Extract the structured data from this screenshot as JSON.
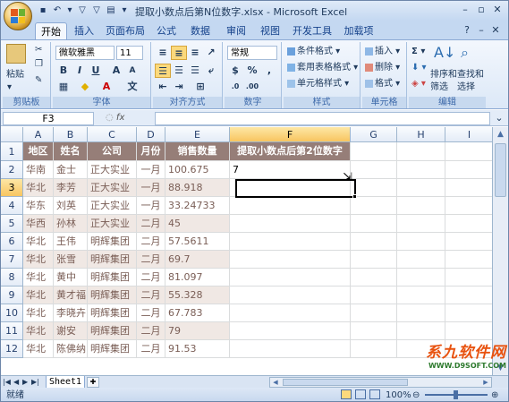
{
  "window": {
    "title": "提取小数点后第N位数字.xlsx - Microsoft Excel"
  },
  "tabs": [
    "开始",
    "插入",
    "页面布局",
    "公式",
    "数据",
    "审阅",
    "视图",
    "开发工具",
    "加载项"
  ],
  "ribbon": {
    "clipboard": {
      "paste": "粘贴",
      "label": "剪贴板"
    },
    "font": {
      "name": "微软雅黑",
      "size": "11",
      "label": "字体"
    },
    "align": {
      "label": "对齐方式"
    },
    "number": {
      "format": "常规",
      "label": "数字"
    },
    "styles": {
      "cond": "条件格式",
      "table": "套用表格格式",
      "cell": "单元格样式",
      "label": "样式"
    },
    "cells": {
      "insert": "插入",
      "delete": "删除",
      "format": "格式",
      "label": "单元格"
    },
    "edit": {
      "sort": "排序和",
      "filter": "筛选",
      "find": "查找和",
      "select": "选择",
      "label": "编辑"
    }
  },
  "formula_bar": {
    "name_box": "F3",
    "fx": "fx",
    "value": ""
  },
  "columns": [
    "A",
    "B",
    "C",
    "D",
    "E",
    "F",
    "G",
    "H",
    "I"
  ],
  "rows": [
    "1",
    "2",
    "3",
    "4",
    "5",
    "6",
    "7",
    "8",
    "9",
    "10",
    "11",
    "12"
  ],
  "table": {
    "headers": [
      "地区",
      "姓名",
      "公司",
      "月份",
      "销售数量",
      "提取小数点后第2位数字"
    ],
    "data": [
      [
        "华南",
        "金士",
        "正大实业",
        "一月",
        "100.675",
        "7"
      ],
      [
        "华北",
        "李芳",
        "正大实业",
        "一月",
        "88.918",
        ""
      ],
      [
        "华东",
        "刘英",
        "正大实业",
        "一月",
        "33.24733",
        ""
      ],
      [
        "华西",
        "孙林",
        "正大实业",
        "二月",
        "45",
        ""
      ],
      [
        "华北",
        "王伟",
        "明辉集团",
        "二月",
        "57.5611",
        ""
      ],
      [
        "华北",
        "张雪",
        "明辉集团",
        "二月",
        "69.7",
        ""
      ],
      [
        "华北",
        "黄中",
        "明辉集团",
        "二月",
        "81.097",
        ""
      ],
      [
        "华北",
        "黄才福",
        "明辉集团",
        "二月",
        "55.328",
        ""
      ],
      [
        "华北",
        "李晓卉",
        "明辉集团",
        "二月",
        "67.783",
        ""
      ],
      [
        "华北",
        "谢安",
        "明辉集团",
        "二月",
        "79",
        ""
      ],
      [
        "华北",
        "陈佛纳",
        "明辉集团",
        "二月",
        "91.53",
        ""
      ]
    ]
  },
  "sheet_tab": "Sheet1",
  "status": {
    "mode": "就绪",
    "zoom": "100%"
  },
  "watermark": {
    "title": "系九软件网",
    "url": "WWW.D9SOFT.COM"
  }
}
